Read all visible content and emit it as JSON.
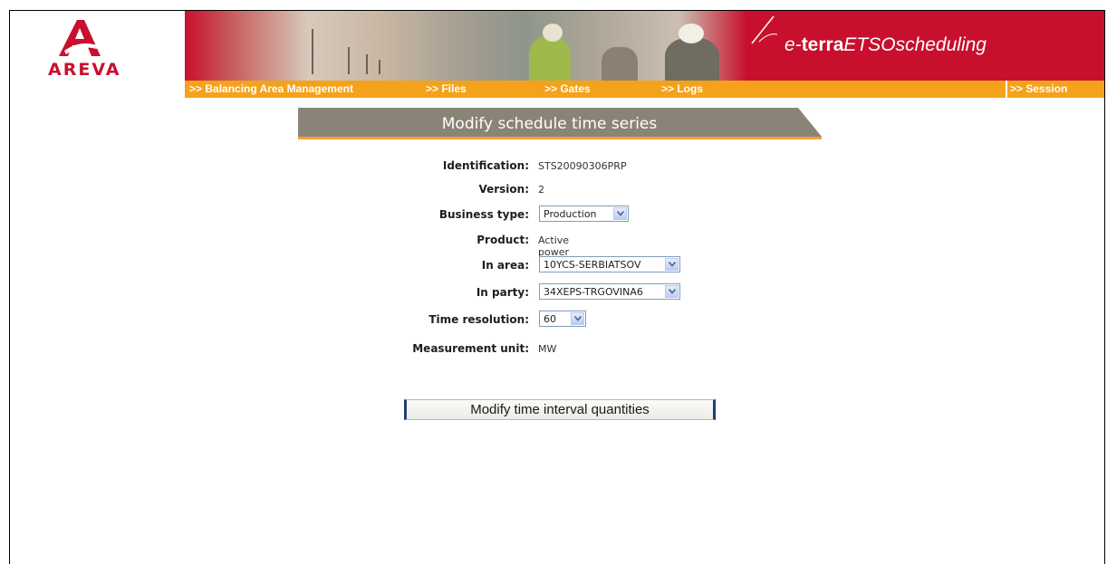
{
  "brand": {
    "company": "AREVA",
    "product_prefix": "e-",
    "product_bold": "terra",
    "product_italic": "ETSOscheduling"
  },
  "nav": {
    "items": [
      ">> Balancing Area Management",
      ">> Files",
      ">> Gates",
      ">> Logs"
    ],
    "session": ">> Session"
  },
  "page": {
    "title": "Modify schedule time series"
  },
  "form": {
    "identification": {
      "label": "Identification:",
      "value": "STS20090306PRP"
    },
    "version": {
      "label": "Version:",
      "value": "2"
    },
    "business_type": {
      "label": "Business type:",
      "selected": "Production"
    },
    "product": {
      "label": "Product:",
      "value": "Active power"
    },
    "in_area": {
      "label": "In area:",
      "selected": "10YCS-SERBIATSOV"
    },
    "in_party": {
      "label": "In party:",
      "selected": "34XEPS-TRGOVINA6"
    },
    "time_resolution": {
      "label": "Time resolution:",
      "selected": "60"
    },
    "measurement_unit": {
      "label": "Measurement unit:",
      "value": "MW"
    }
  },
  "actions": {
    "modify_quantities": "Modify time interval quantities"
  },
  "colors": {
    "brand_red": "#c8102e",
    "nav_orange": "#f5a21b",
    "ribbon_gray": "#8a8478",
    "ribbon_accent": "#f0a030"
  }
}
